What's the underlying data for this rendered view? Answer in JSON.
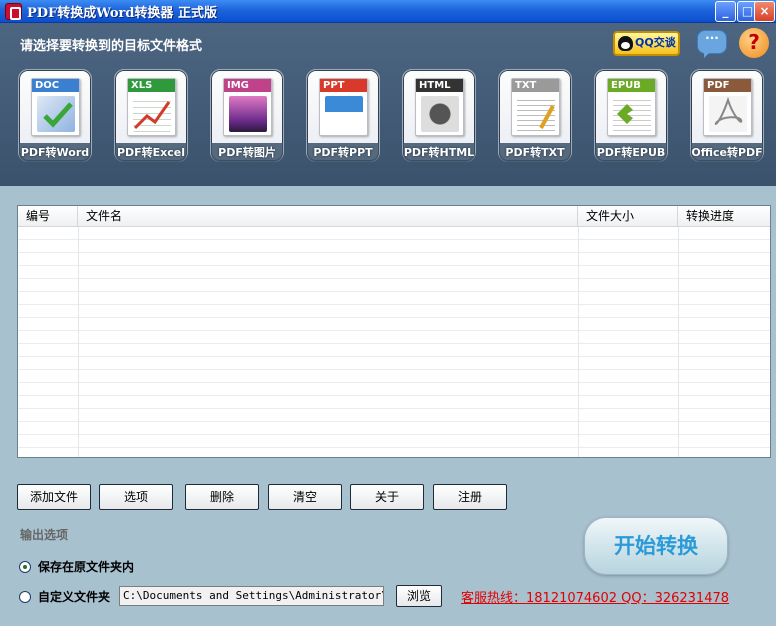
{
  "window": {
    "title": "PDF转换成Word转换器 正式版",
    "controls": {
      "minimize": "_",
      "maximize": "□",
      "close": "×"
    }
  },
  "header": {
    "label": "请选择要转换到的目标文件格式",
    "qq_chat": "QQ交谈",
    "help": "?"
  },
  "formats": [
    {
      "badge": "DOC",
      "label": "PDF转Word",
      "color": "#3a7fd0"
    },
    {
      "badge": "XLS",
      "label": "PDF转Excel",
      "color": "#2e9a3c"
    },
    {
      "badge": "IMG",
      "label": "PDF转图片",
      "color": "#c0428a"
    },
    {
      "badge": "PPT",
      "label": "PDF转PPT",
      "color": "#d8392b"
    },
    {
      "badge": "HTML",
      "label": "PDF转HTML",
      "color": "#333333"
    },
    {
      "badge": "TXT",
      "label": "PDF转TXT",
      "color": "#9a9a9a"
    },
    {
      "badge": "EPUB",
      "label": "PDF转EPUB",
      "color": "#6aaa24"
    },
    {
      "badge": "PDF",
      "label": "Office转PDF",
      "color": "#8a5a3a"
    }
  ],
  "table": {
    "columns": {
      "no": "编号",
      "name": "文件名",
      "size": "文件大小",
      "progress": "转换进度"
    },
    "rows": []
  },
  "actions": {
    "add_file": "添加文件",
    "options": "选项",
    "delete": "删除",
    "clear": "清空",
    "about": "关于",
    "register": "注册"
  },
  "output": {
    "label": "输出选项",
    "save_original": "保存在原文件夹内",
    "custom_folder": "自定义文件夹",
    "path": "C:\\Documents and Settings\\Administrator\\桌面",
    "browse": "浏览",
    "selected": "save_original"
  },
  "hotline": "客服热线：18121074602 QQ：326231478",
  "start_button": "开始转换"
}
